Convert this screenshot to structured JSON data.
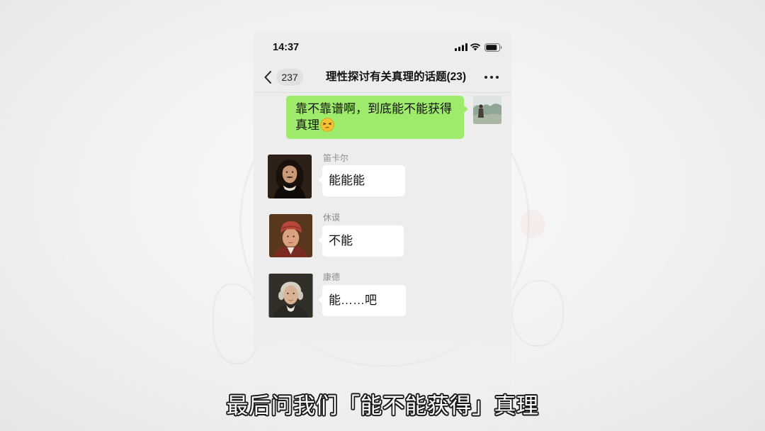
{
  "status_bar": {
    "time": "14:37",
    "icons": [
      "cellular-signal-icon",
      "wifi-icon",
      "battery-icon"
    ]
  },
  "nav": {
    "back_icon": "chevron-left-icon",
    "unread_count": "237",
    "title": "理性探讨有关真理的话题(23)",
    "more_icon": "more-dots-icon"
  },
  "messages": [
    {
      "direction": "outgoing",
      "text": "靠不靠谱啊，到底能不能获得真理",
      "emoji": "tired-face-icon",
      "avatar": "self-avatar-photo"
    },
    {
      "direction": "incoming",
      "sender": "笛卡尔",
      "text": "能能能",
      "avatar": "descartes-portrait"
    },
    {
      "direction": "incoming",
      "sender": "休谟",
      "text": "不能",
      "avatar": "hume-portrait"
    },
    {
      "direction": "incoming",
      "sender": "康德",
      "text": "能……吧",
      "avatar": "kant-portrait"
    }
  ],
  "subtitle": "最后问我们「能不能获得」真理",
  "colors": {
    "chat_background": "#ededed",
    "outgoing_bubble": "#9eea6a",
    "incoming_bubble": "#ffffff"
  }
}
